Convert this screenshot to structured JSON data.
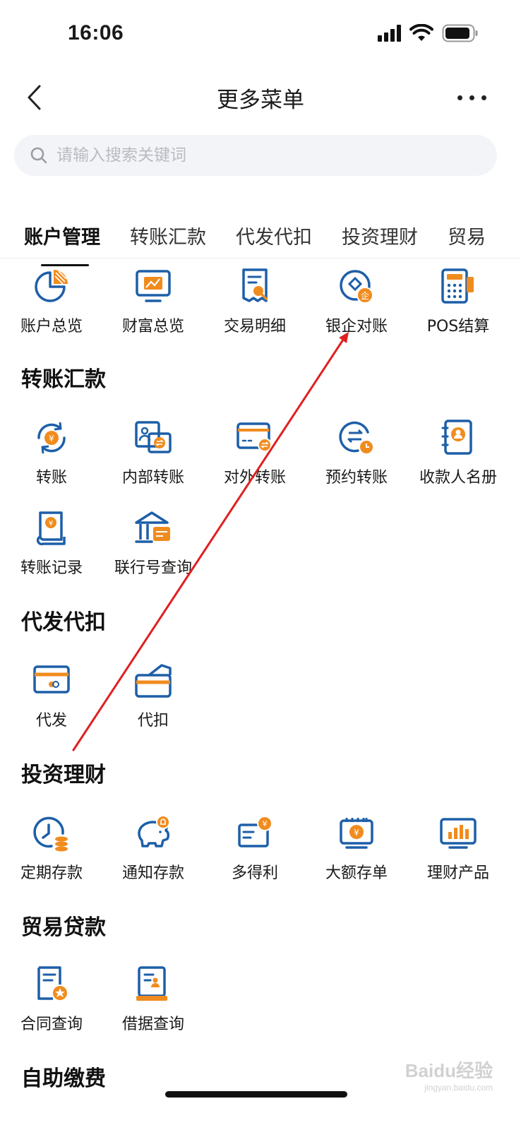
{
  "status_bar": {
    "time": "16:06"
  },
  "nav": {
    "title": "更多菜单"
  },
  "search": {
    "placeholder": "请输入搜索关键词"
  },
  "tabs": [
    {
      "label": "账户管理",
      "active": true
    },
    {
      "label": "转账汇款"
    },
    {
      "label": "代发代扣"
    },
    {
      "label": "投资理财"
    },
    {
      "label": "贸易"
    }
  ],
  "account_items": [
    {
      "label": "账户总览",
      "icon": "pie-chart-icon"
    },
    {
      "label": "财富总览",
      "icon": "monitor-chart-icon"
    },
    {
      "label": "交易明细",
      "icon": "receipt-search-icon"
    },
    {
      "label": "银企对账",
      "icon": "enterprise-reconcile-icon"
    },
    {
      "label": "POS结算",
      "icon": "pos-terminal-icon"
    }
  ],
  "sections": [
    {
      "title": "转账汇款",
      "items": [
        {
          "label": "转账",
          "icon": "yuan-cycle-icon"
        },
        {
          "label": "内部转账",
          "icon": "internal-transfer-icon"
        },
        {
          "label": "对外转账",
          "icon": "card-transfer-icon"
        },
        {
          "label": "预约转账",
          "icon": "scheduled-transfer-icon"
        },
        {
          "label": "收款人名册",
          "icon": "contact-book-icon"
        },
        {
          "label": "转账记录",
          "icon": "transfer-record-icon"
        },
        {
          "label": "联行号查询",
          "icon": "bank-query-icon"
        }
      ]
    },
    {
      "title": "代发代扣",
      "items": [
        {
          "label": "代发",
          "icon": "payroll-card-icon"
        },
        {
          "label": "代扣",
          "icon": "withhold-card-icon"
        }
      ]
    },
    {
      "title": "投资理财",
      "items": [
        {
          "label": "定期存款",
          "icon": "time-deposit-icon"
        },
        {
          "label": "通知存款",
          "icon": "piggy-bank-icon"
        },
        {
          "label": "多得利",
          "icon": "wallet-yuan-icon"
        },
        {
          "label": "大额存单",
          "icon": "certificate-deposit-icon"
        },
        {
          "label": "理财产品",
          "icon": "bar-chart-screen-icon"
        }
      ]
    },
    {
      "title": "贸易贷款",
      "items": [
        {
          "label": "合同查询",
          "icon": "contract-icon"
        },
        {
          "label": "借据查询",
          "icon": "loan-receipt-icon"
        }
      ]
    },
    {
      "title": "自助缴费",
      "items": []
    }
  ],
  "colors": {
    "primary_blue": "#1d5fa8",
    "accent_orange": "#f08c1e",
    "annotation_red": "#e02020"
  },
  "watermark": {
    "brand": "Baidu经验",
    "url": "jingyan.baidu.com"
  }
}
